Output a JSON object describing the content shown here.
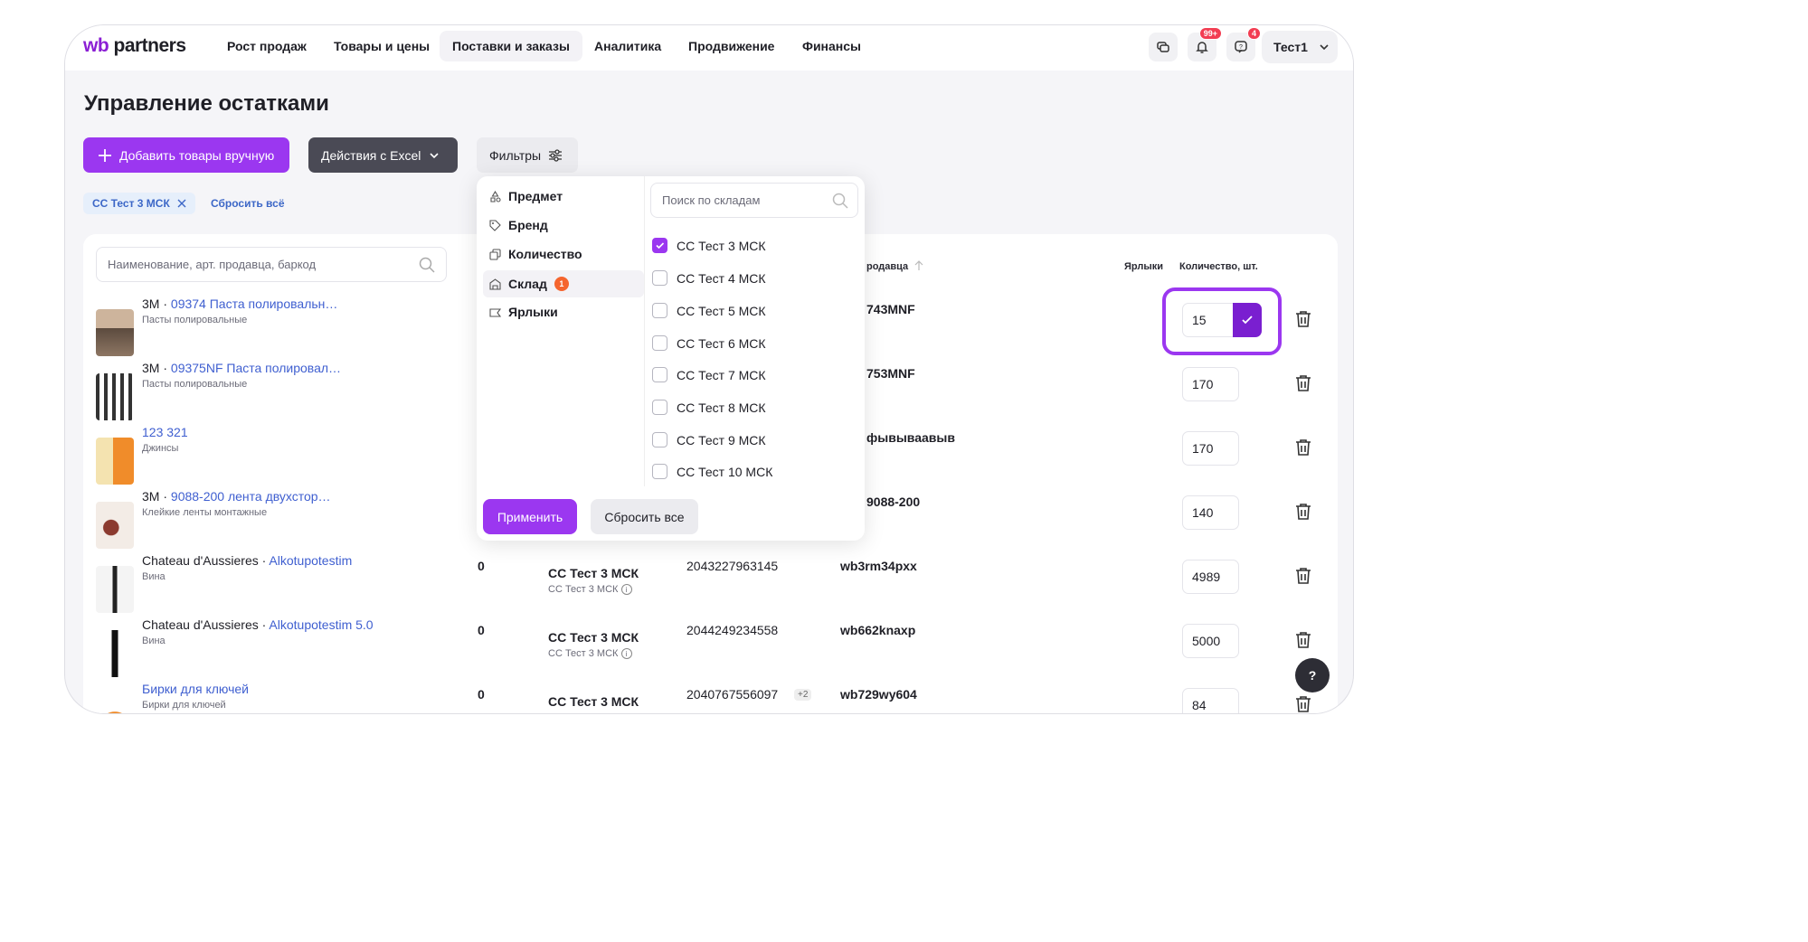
{
  "header": {
    "logo_wb": "wb",
    "logo_rest": " partners",
    "nav": [
      "Рост продаж",
      "Товары и цены",
      "Поставки и заказы",
      "Аналитика",
      "Продвижение",
      "Финансы"
    ],
    "notif_badge": "99+",
    "support_badge": "4",
    "user": "Тест1"
  },
  "page": {
    "title": "Управление остатками",
    "add_button": "Добавить товары вручную",
    "excel_button": "Действия с Excel",
    "filters_button": "Фильтры",
    "active_chip": "СС Тест 3 МСК",
    "reset_all": "Сбросить всё"
  },
  "table": {
    "search_placeholder": "Наименование, арт. продавца, баркод",
    "col_seller_art": "родавца",
    "col_labels": "Ярлыки",
    "col_qty": "Количество, шт.",
    "rows": [
      {
        "brand": "3M",
        "name": "09374 Паста полировальн…",
        "sub": "Пасты полировальные",
        "count": "",
        "wh": "",
        "wh_sub": "",
        "barcode": "",
        "extra": "",
        "art": "743MNF",
        "qty": "15"
      },
      {
        "brand": "3M",
        "name": "09375NF Паста полировал…",
        "sub": "Пасты полировальные",
        "count": "",
        "wh": "",
        "wh_sub": "",
        "barcode": "",
        "extra": "",
        "art": "753MNF",
        "qty": "170"
      },
      {
        "brand": "",
        "name": "123 321",
        "sub": "Джинсы",
        "count": "",
        "wh": "",
        "wh_sub": "",
        "barcode": "",
        "extra": "",
        "art": "фывываавыв",
        "qty": "170"
      },
      {
        "brand": "3M",
        "name": "9088-200 лента двухстор…",
        "sub": "Клейкие ленты монтажные",
        "count": "",
        "wh": "",
        "wh_sub": "",
        "barcode": "",
        "extra": "",
        "art": "9088-200",
        "qty": "140"
      },
      {
        "brand": "Chateau d'Aussieres",
        "name": "Alkotupotestim",
        "sub": "Вина",
        "count": "0",
        "wh": "СС Тест 3 МСК",
        "wh_sub": "СС Тест 3 МСК",
        "barcode": "2043227963145",
        "extra": "",
        "art": "wb3rm34pxx",
        "qty": "4989"
      },
      {
        "brand": "Chateau d'Aussieres",
        "name": "Alkotupotestim 5.0",
        "sub": "Вина",
        "count": "0",
        "wh": "СС Тест 3 МСК",
        "wh_sub": "СС Тест 3 МСК",
        "barcode": "2044249234558",
        "extra": "",
        "art": "wb662knaxp",
        "qty": "5000"
      },
      {
        "brand": "",
        "name": "Бирки для ключей",
        "sub": "Бирки для ключей",
        "count": "0",
        "wh": "СС Тест 3 МСК",
        "wh_sub": "",
        "barcode": "2040767556097",
        "extra": "+2",
        "art": "wb729wy604",
        "qty": "84"
      }
    ]
  },
  "filter_dropdown": {
    "menu": [
      "Предмет",
      "Бренд",
      "Количество",
      "Склад",
      "Ярлыки"
    ],
    "selected_menu": "Склад",
    "selected_count": "1",
    "search_placeholder": "Поиск по складам",
    "options": [
      {
        "label": "СС Тест 3 МСК",
        "checked": true
      },
      {
        "label": "СС Тест 4 МСК",
        "checked": false
      },
      {
        "label": "СС Тест 5 МСК",
        "checked": false
      },
      {
        "label": "СС Тест 6 МСК",
        "checked": false
      },
      {
        "label": "СС Тест 7 МСК",
        "checked": false
      },
      {
        "label": "СС Тест 8 МСК",
        "checked": false
      },
      {
        "label": "СС Тест 9 МСК",
        "checked": false
      },
      {
        "label": "СС Тест 10 МСК",
        "checked": false
      }
    ],
    "apply": "Применить",
    "reset": "Сбросить все"
  },
  "help": "?"
}
